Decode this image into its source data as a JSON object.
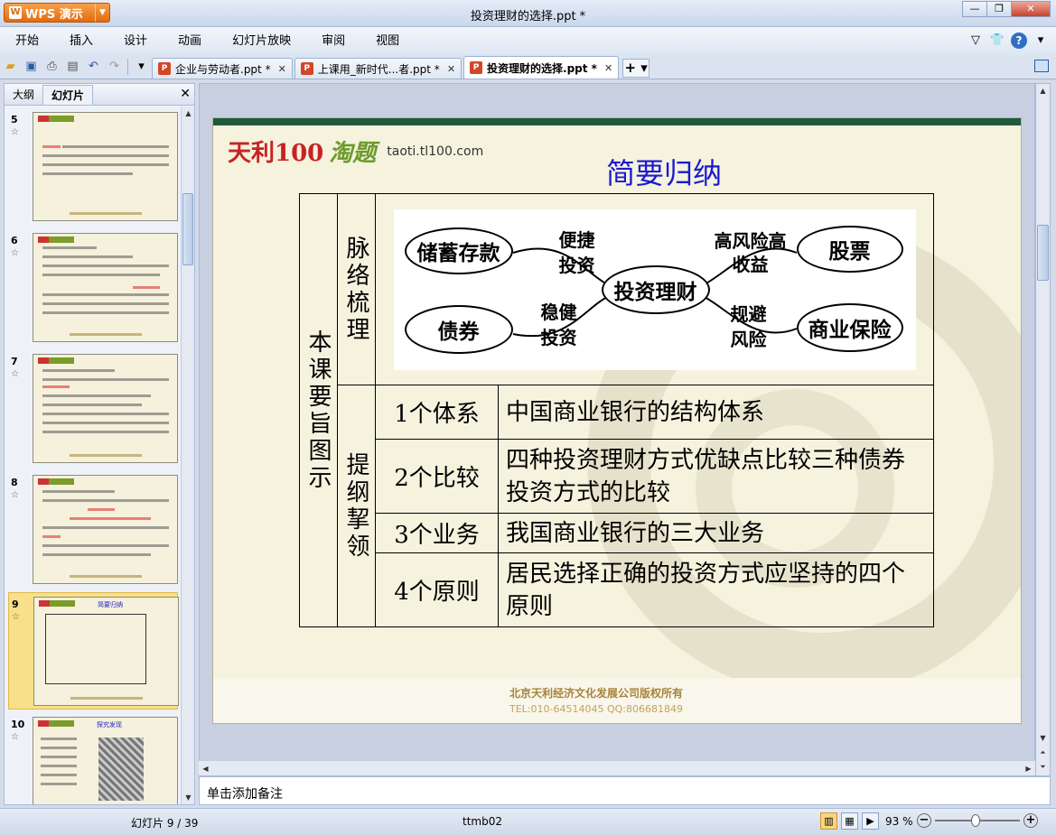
{
  "app": {
    "name": "WPS 演示",
    "doc_title": "投资理财的选择.ppt *"
  },
  "menu": [
    "开始",
    "插入",
    "设计",
    "动画",
    "幻灯片放映",
    "审阅",
    "视图"
  ],
  "tabs": [
    {
      "label": "企业与劳动者.ppt *",
      "active": false
    },
    {
      "label": "上课用_新时代...者.ppt *",
      "active": false
    },
    {
      "label": "投资理财的选择.ppt *",
      "active": true
    }
  ],
  "left_panel": {
    "tabs": [
      "大纲",
      "幻灯片"
    ],
    "active_tab": "幻灯片",
    "slides": [
      {
        "num": "5"
      },
      {
        "num": "6"
      },
      {
        "num": "7"
      },
      {
        "num": "8"
      },
      {
        "num": "9",
        "selected": true,
        "title": "简要归纳"
      },
      {
        "num": "10",
        "title": "探究发现"
      }
    ]
  },
  "slide": {
    "logo_text": "天利100",
    "logo_tag": "淘题",
    "logo_url": "taoti.tl100.com",
    "title": "简要归纳",
    "col1": "本课要旨图示",
    "row1_label": "脉络梳理",
    "row2_label": "提纲挈领",
    "mindmap": {
      "center": "投资理财",
      "nodes": [
        "储蓄存款",
        "债券",
        "股票",
        "商业保险"
      ],
      "edges": [
        "便捷投资",
        "稳健投资",
        "高风险高收益",
        "规避风险"
      ]
    },
    "outline": [
      {
        "num": "1个体系",
        "desc": "中国商业银行的结构体系"
      },
      {
        "num": "2个比较",
        "desc": "四种投资理财方式优缺点比较三种债券投资方式的比较"
      },
      {
        "num": "3个业务",
        "desc": "我国商业银行的三大业务"
      },
      {
        "num": "4个原则",
        "desc": "居民选择正确的投资方式应坚持的四个原则"
      }
    ],
    "footer_line1": "北京天利经济文化发展公司版权所有",
    "footer_line2": "TEL:010-64514045   QQ:806681849"
  },
  "notes_placeholder": "单击添加备注",
  "status": {
    "slide_counter": "幻灯片 9 / 39",
    "theme": "ttmb02",
    "zoom": "93 %",
    "zoom_level": 0.48
  }
}
